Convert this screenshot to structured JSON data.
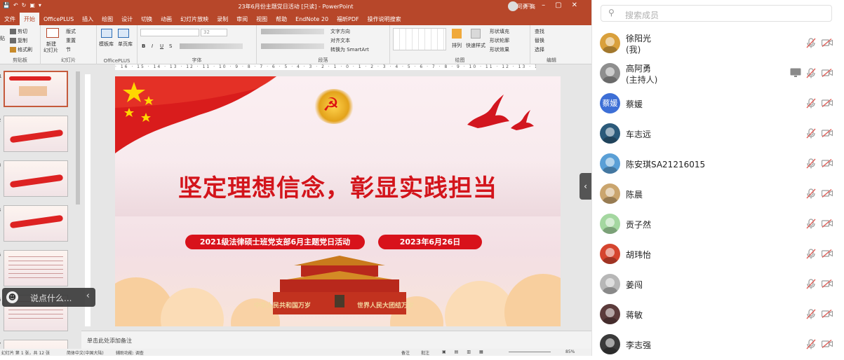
{
  "ppt": {
    "title": "23年6月份主题党日活动 [只读] - PowerPoint",
    "user": "阿勇 高",
    "tabs": [
      "文件",
      "开始",
      "OfficePLUS",
      "插入",
      "绘图",
      "设计",
      "切换",
      "动画",
      "幻灯片放映",
      "录制",
      "审阅",
      "视图",
      "帮助",
      "EndNote 20",
      "福昕PDF",
      "操作说明搜索"
    ],
    "ribbon": {
      "clipboard": {
        "cut": "剪切",
        "copy": "复制",
        "paste_fmt": "格式刷",
        "group": "剪贴板",
        "paste": "贴"
      },
      "slides": {
        "new": "新建",
        "new2": "幻灯片",
        "layout": "版式",
        "reset": "重置",
        "section": "节",
        "group": "幻灯片"
      },
      "officeplus": {
        "template": "模板库",
        "single": "单页库",
        "group": "OfficePLUS"
      },
      "font": {
        "size": "32",
        "group": "字体",
        "bold": "B",
        "italic": "I",
        "underline": "U",
        "strike": "S"
      },
      "paragraph": {
        "textdir": "文字方向",
        "align": "对齐文本",
        "smartart": "转换为 SmartArt",
        "group": "段落"
      },
      "drawing": {
        "arrange": "排列",
        "quickstyle": "快速样式",
        "fill": "形状填充",
        "outline": "形状轮廓",
        "effect": "形状效果",
        "group": "绘图"
      },
      "editing": {
        "find": "查找",
        "replace": "替换",
        "select": "选择",
        "group": "编辑"
      }
    },
    "thumbnail_numbers": [
      "1",
      "2",
      "3",
      "4",
      "5",
      "6",
      "7"
    ],
    "notes_placeholder": "单击此处添加备注",
    "status": {
      "slide_of": "幻灯片 第 1 张，共 12 张",
      "language": "简体中文(中国大陆)",
      "accessibility": "辅助功能: 调查",
      "notes": "备注",
      "comments": "批注",
      "zoom": "85%"
    }
  },
  "slide": {
    "title": "坚定理想信念，彰显实践担当",
    "subtitle": "2021级法律硕士班党支部6月主题党日活动",
    "date": "2023年6月26日",
    "banner_left": "中华人民共和国万岁",
    "banner_right": "世界人民大团结万岁"
  },
  "chat": {
    "placeholder": "说点什么..."
  },
  "panel": {
    "search_placeholder": "搜索成员",
    "members": [
      {
        "name": "徐阳光",
        "sub": "(我)",
        "avatar": "#d9a03c"
      },
      {
        "name": "高阿勇",
        "sub": "(主持人)",
        "avatar": "#8e8e8e",
        "sharing": true
      },
      {
        "name": "蔡媛",
        "sub": "",
        "avatar": "#3d6fd6",
        "initials": "蔡媛"
      },
      {
        "name": "车志远",
        "sub": "",
        "avatar": "#2b5a7a"
      },
      {
        "name": "陈安琪SA21216015",
        "sub": "",
        "avatar": "#5a9fd6"
      },
      {
        "name": "陈晨",
        "sub": "",
        "avatar": "#caa56e"
      },
      {
        "name": "贡子然",
        "sub": "",
        "avatar": "#a4d7a0"
      },
      {
        "name": "胡玮怡",
        "sub": "",
        "avatar": "#d5452f"
      },
      {
        "name": "姜闯",
        "sub": "",
        "avatar": "#b7b7b7"
      },
      {
        "name": "蒋敏",
        "sub": "",
        "avatar": "#5b3b3b"
      },
      {
        "name": "李志强",
        "sub": "",
        "avatar": "#3a3a3a"
      }
    ],
    "colors": {
      "muted": "#e0605a",
      "icon_gray": "#9a9a9a"
    }
  }
}
